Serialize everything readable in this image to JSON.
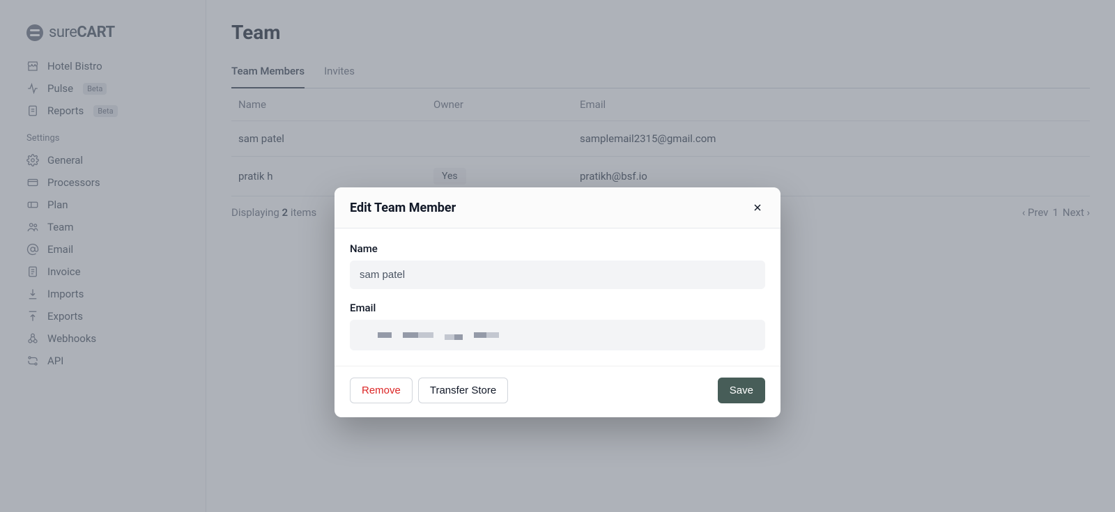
{
  "logo": {
    "light": "sure",
    "bold": "CART"
  },
  "sidebar": {
    "top": [
      {
        "label": "Hotel Bistro",
        "icon": "store",
        "badge": null
      },
      {
        "label": "Pulse",
        "icon": "pulse",
        "badge": "Beta"
      },
      {
        "label": "Reports",
        "icon": "reports",
        "badge": "Beta"
      }
    ],
    "settings_title": "Settings",
    "settings": [
      {
        "label": "General",
        "icon": "gear"
      },
      {
        "label": "Processors",
        "icon": "processors"
      },
      {
        "label": "Plan",
        "icon": "ticket"
      },
      {
        "label": "Team",
        "icon": "team"
      },
      {
        "label": "Email",
        "icon": "at"
      },
      {
        "label": "Invoice",
        "icon": "invoice"
      },
      {
        "label": "Imports",
        "icon": "download"
      },
      {
        "label": "Exports",
        "icon": "upload"
      },
      {
        "label": "Webhooks",
        "icon": "webhooks"
      },
      {
        "label": "API",
        "icon": "api"
      }
    ]
  },
  "page": {
    "title": "Team",
    "tabs": [
      {
        "label": "Team Members",
        "active": true
      },
      {
        "label": "Invites",
        "active": false
      }
    ]
  },
  "table": {
    "headers": {
      "name": "Name",
      "owner": "Owner",
      "email": "Email"
    },
    "rows": [
      {
        "name": "sam patel",
        "owner": "",
        "email": "samplemail2315@gmail.com"
      },
      {
        "name": "pratik h",
        "owner": "Yes",
        "email": "pratikh@bsf.io"
      }
    ],
    "footer": {
      "displaying_prefix": "Displaying ",
      "count": "2",
      "displaying_suffix": " items",
      "prev": "‹ Prev",
      "page": "1",
      "next": "Next ›"
    }
  },
  "modal": {
    "title": "Edit Team Member",
    "fields": {
      "name_label": "Name",
      "name_value": "sam patel",
      "email_label": "Email"
    },
    "buttons": {
      "remove": "Remove",
      "transfer": "Transfer Store",
      "save": "Save"
    }
  },
  "colors": {
    "accent": "#475d58",
    "danger": "#dc2626",
    "arrow": "#e11010"
  }
}
